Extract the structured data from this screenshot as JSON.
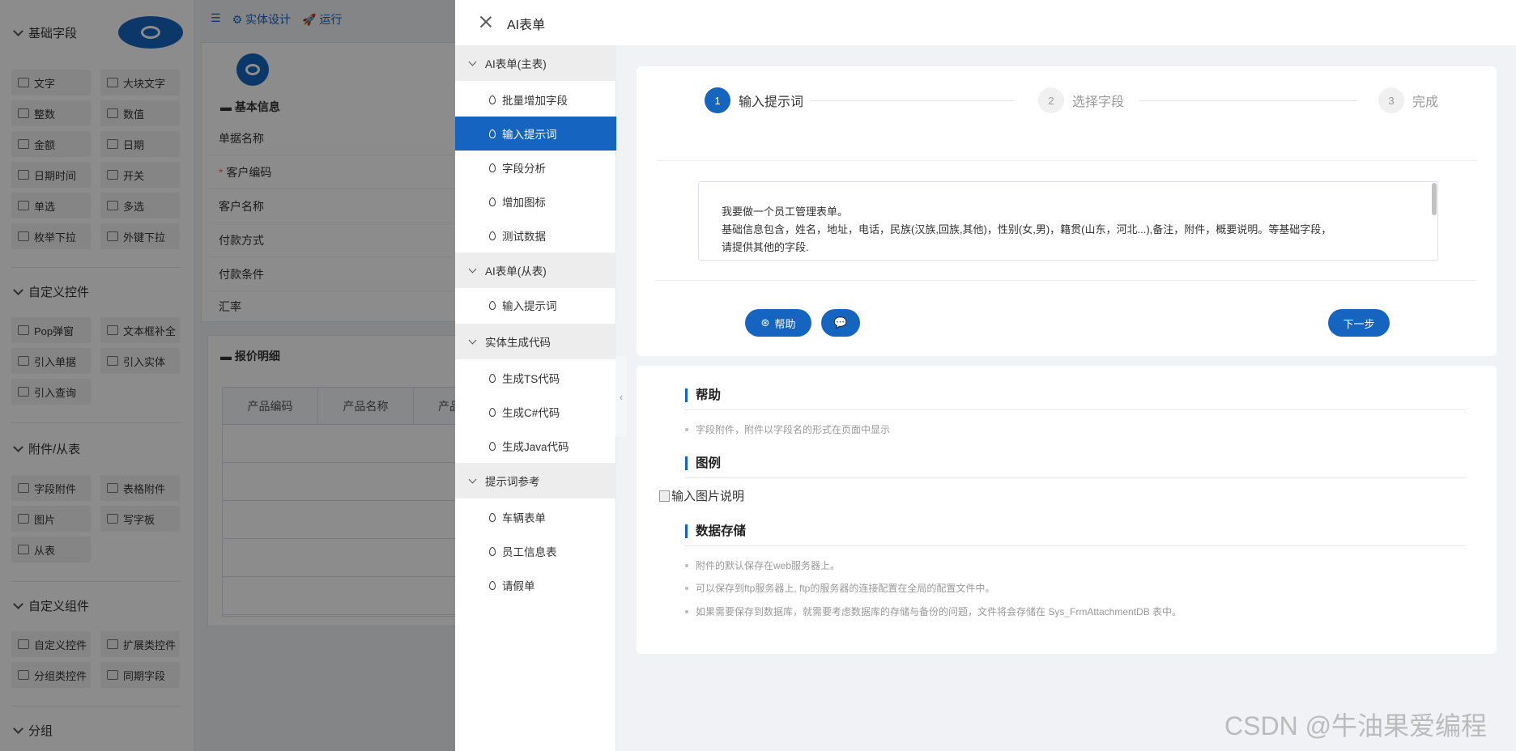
{
  "left_panel": {
    "groups": [
      {
        "label": "基础字段",
        "items": [
          "文字",
          "大块文字",
          "整数",
          "数值",
          "金额",
          "日期",
          "日期时间",
          "开关",
          "单选",
          "多选",
          "枚举下拉",
          "外键下拉"
        ]
      },
      {
        "label": "自定义控件",
        "items": [
          "Pop弹窗",
          "文本框补全",
          "引入单据",
          "引入实体",
          "引入查询"
        ]
      },
      {
        "label": "附件/从表",
        "items": [
          "字段附件",
          "表格附件",
          "图片",
          "写字板",
          "从表"
        ]
      },
      {
        "label": "自定义组件",
        "items": [
          "自定义控件",
          "扩展类控件",
          "分组类控件",
          "同期字段"
        ]
      },
      {
        "label": "分组",
        "items": []
      }
    ]
  },
  "toolbar": {
    "entity_design": "实体设计",
    "run": "运行"
  },
  "form": {
    "section_basic": "基本信息",
    "fields": [
      "单据名称",
      "客户编码",
      "客户名称",
      "付款方式",
      "付款条件",
      "汇率"
    ],
    "section_detail": "报价明细",
    "columns": [
      "产品编码",
      "产品名称",
      "产品"
    ]
  },
  "drawer": {
    "title": "AI表单",
    "menu": [
      {
        "group": "AI表单(主表)",
        "items": [
          "批量增加字段",
          "输入提示词",
          "字段分析",
          "增加图标",
          "测试数据"
        ]
      },
      {
        "group": "AI表单(从表)",
        "items": [
          "输入提示词"
        ]
      },
      {
        "group": "实体生成代码",
        "items": [
          "生成TS代码",
          "生成C#代码",
          "生成Java代码"
        ]
      },
      {
        "group": "提示词参考",
        "items": [
          "车辆表单",
          "员工信息表",
          "请假单"
        ]
      }
    ],
    "active_item": "输入提示词",
    "steps": [
      {
        "num": "1",
        "label": "输入提示词",
        "status": "active"
      },
      {
        "num": "2",
        "label": "选择字段",
        "status": "wait"
      },
      {
        "num": "3",
        "label": "完成",
        "status": "wait"
      }
    ],
    "prompt_text": "我要做一个员工管理表单。\n基础信息包含，姓名，地址，电话，民族(汉族,回族,其他)，性别(女,男)，籍贯(山东，河北...),备注，附件，概要说明。等基础字段，\n请提供其他的字段.",
    "buttons": {
      "help": "帮助",
      "next": "下一步"
    },
    "help": {
      "h_help": "帮助",
      "help_items": [
        "字段附件，附件以字段名的形式在页面中显示"
      ],
      "h_example": "图例",
      "image_alt": "输入图片说明",
      "h_storage": "数据存储",
      "storage_items": [
        "附件的默认保存在web服务器上。",
        "可以保存到ftp服务器上, ftp的服务器的连接配置在全局的配置文件中。",
        "如果需要保存到数据库，就需要考虑数据库的存储与备份的问题，文件将会存储在 Sys_FrmAttachmentDB 表中。"
      ]
    }
  },
  "watermark": "CSDN @牛油果爱编程",
  "colors": {
    "accent": "#1565c0",
    "overlay": "rgba(0,0,0,0.45)"
  }
}
